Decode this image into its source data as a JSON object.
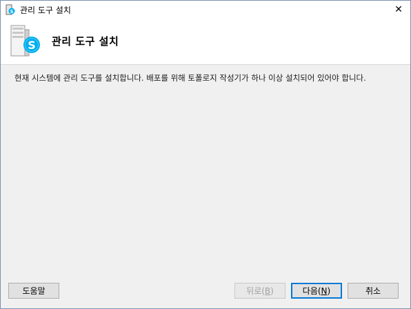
{
  "window": {
    "title": "관리 도구 설치",
    "close_glyph": "✕"
  },
  "header": {
    "title": "관리 도구 설치"
  },
  "description": "현재 시스템에 관리 도구를 설치합니다. 배포를 위해 토폴로지 작성기가 하나 이상 설치되어 있어야 합니다.",
  "buttons": {
    "help": "도움말",
    "back_label": "뒤로(",
    "back_key": "B",
    "back_suffix": ")",
    "next_label": "다음(",
    "next_key": "N",
    "next_suffix": ")",
    "cancel": "취소"
  },
  "colors": {
    "accent": "#0078d7",
    "skype_blue": "#00aff0"
  },
  "icons": {
    "app": "skype-setup-icon",
    "close": "close-icon",
    "header": "server-skype-icon"
  }
}
